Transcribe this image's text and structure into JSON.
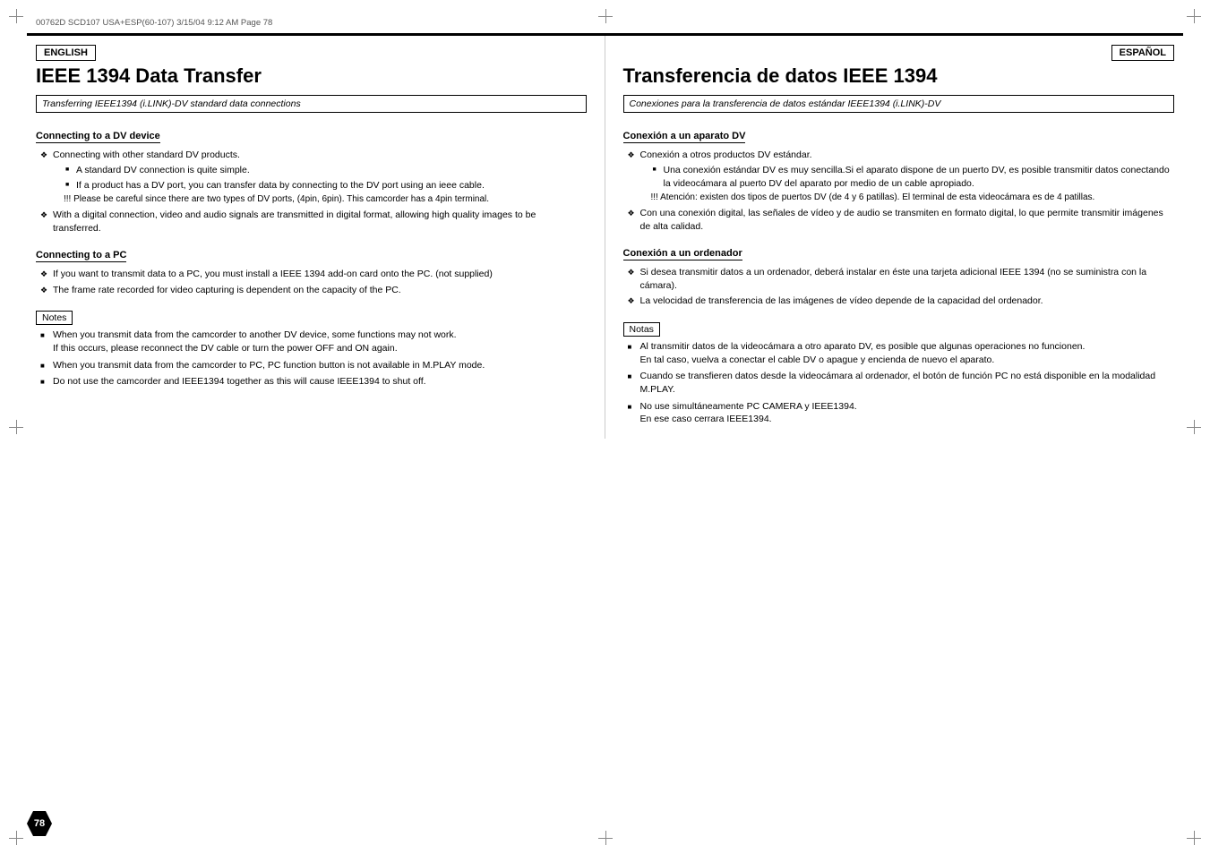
{
  "meta": {
    "file_info": "00762D SCD107 USA+ESP(60-107)   3/15/04  9:12 AM   Page 78"
  },
  "page_number": "78",
  "left_col": {
    "lang_badge": "ENGLISH",
    "title": "IEEE 1394 Data Transfer",
    "subtitle": "Transferring IEEE1394 (i.LINK)-DV standard data connections",
    "section1": {
      "heading": "Connecting to a DV device",
      "bullets": [
        {
          "text": "Connecting with other standard DV products.",
          "sub_bullets": [
            "A standard DV connection is quite simple.",
            "If a product has a DV port, you can transfer data by connecting to the DV port using an ieee cable."
          ],
          "notes": [
            "Please be careful since there are two types of DV ports, (4pin, 6pin). This camcorder has a 4pin terminal."
          ]
        },
        {
          "text": "With a digital connection, video and audio signals are transmitted in digital format, allowing high quality images to be transferred."
        }
      ]
    },
    "section2": {
      "heading": "Connecting to a PC",
      "bullets": [
        "If you want to transmit data to a PC, you must install a IEEE 1394 add-on card onto the PC. (not supplied)",
        "The frame rate recorded for video capturing is dependent on the capacity of the PC."
      ]
    },
    "notes_label": "Notes",
    "notes_items": [
      "When you transmit data from the camcorder to another DV device, some functions may not work.\nIf this occurs, please reconnect the DV cable or turn the power OFF and ON again.",
      "When you transmit data from the camcorder to PC, PC function button is not available in M.PLAY mode.",
      "Do not use the camcorder and IEEE1394 together as this will cause IEEE1394 to shut off."
    ]
  },
  "right_col": {
    "lang_badge": "ESPAÑOL",
    "title": "Transferencia de datos IEEE 1394",
    "subtitle": "Conexiones para la transferencia de datos estándar IEEE1394 (i.LINK)-DV",
    "section1": {
      "heading": "Conexión a un aparato DV",
      "bullets": [
        {
          "text": "Conexión a otros productos DV estándar.",
          "sub_bullets": [
            "Una conexión estándar DV es muy sencilla.Si el aparato dispone de un puerto DV, es posible transmitir datos conectando la videocámara al puerto DV del aparato por medio de un cable apropiado."
          ],
          "notes": [
            "Atención: existen dos tipos de puertos DV (de 4 y 6 patillas). El terminal de esta videocámara es de 4 patillas."
          ]
        },
        {
          "text": "Con una conexión digital, las señales de vídeo y de audio se transmiten en formato digital, lo que permite transmitir imágenes de alta calidad."
        }
      ]
    },
    "section2": {
      "heading": "Conexión a un ordenador",
      "bullets": [
        "Si desea transmitir datos a un ordenador, deberá instalar en éste una tarjeta adicional IEEE 1394 (no se suministra con la cámara).",
        "La velocidad de transferencia de las imágenes de vídeo depende de la capacidad del ordenador."
      ]
    },
    "notes_label": "Notas",
    "notes_items": [
      "Al transmitir datos de la videocámara a otro aparato DV, es posible que algunas operaciones no funcionen.\nEn tal caso, vuelva a conectar el cable DV o apague y encienda de nuevo el aparato.",
      "Cuando se transfieren datos desde la videocámara al ordenador, el botón de función PC no está disponible en la modalidad M.PLAY.",
      "No use simultáneamente PC CAMERA y IEEE1394.\nEn ese caso cerrara IEEE1394."
    ]
  }
}
